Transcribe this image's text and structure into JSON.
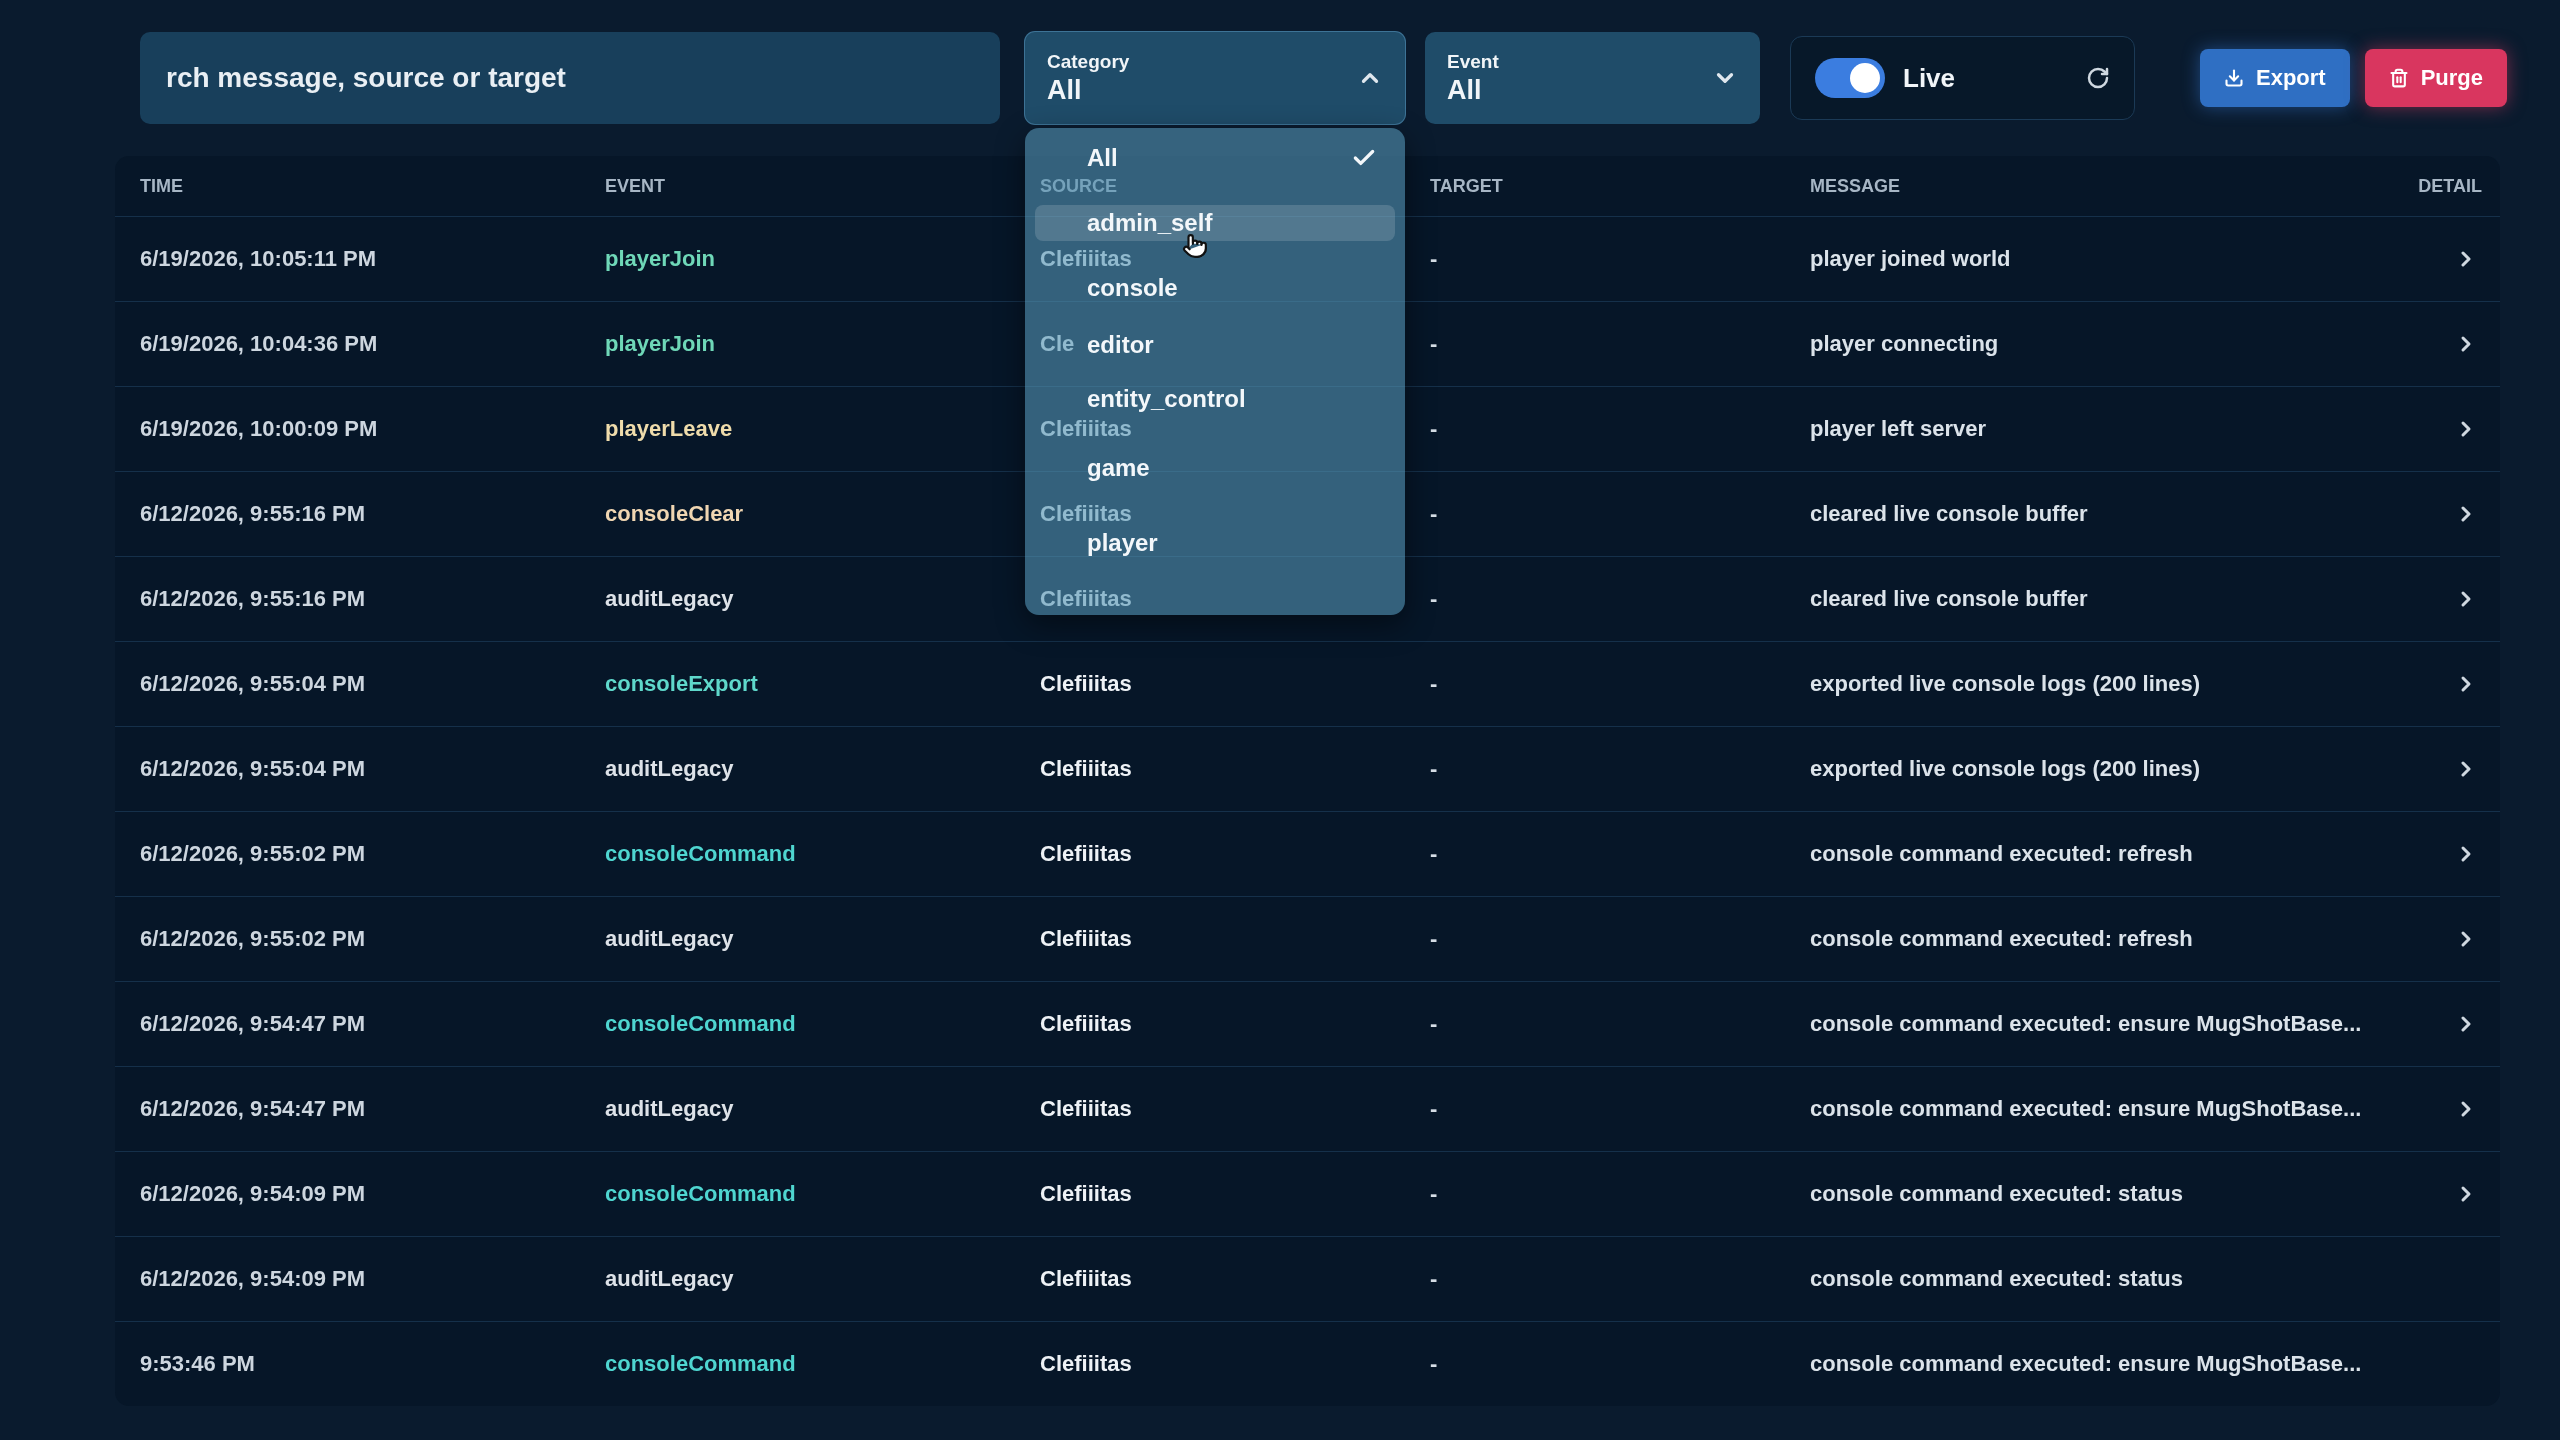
{
  "toolbar": {
    "search": {
      "placeholder": "rch message, source or target"
    },
    "category": {
      "label": "Category",
      "value": "All",
      "expanded": true,
      "options": [
        {
          "label": "All",
          "selected": true,
          "hovered": false
        },
        {
          "label": "admin_self",
          "selected": false,
          "hovered": true
        },
        {
          "label": "console",
          "selected": false,
          "hovered": false
        },
        {
          "label": "editor",
          "selected": false,
          "hovered": false
        },
        {
          "label": "entity_control",
          "selected": false,
          "hovered": false
        },
        {
          "label": "game",
          "selected": false,
          "hovered": false
        },
        {
          "label": "player",
          "selected": false,
          "hovered": false
        }
      ]
    },
    "event": {
      "label": "Event",
      "value": "All",
      "expanded": false
    },
    "live": {
      "label": "Live",
      "on": true
    },
    "buttons": [
      {
        "kind": "export",
        "label": "Export"
      },
      {
        "kind": "purge",
        "label": "Purge"
      }
    ]
  },
  "table": {
    "columns": [
      "TIME",
      "EVENT",
      "SOURCE",
      "TARGET",
      "MESSAGE",
      "DETAIL"
    ],
    "rows": [
      {
        "time": "6/19/2026, 10:05:11 PM",
        "event": "playerJoin",
        "color": "#6fd8b8",
        "source": "Clefiiitas",
        "target": "-",
        "message": "player joined world",
        "detail_arrow": true
      },
      {
        "time": "6/19/2026, 10:04:36 PM",
        "event": "playerJoin",
        "color": "#6fd8b8",
        "source": "Cle",
        "target": "-",
        "message": "player connecting",
        "detail_arrow": true
      },
      {
        "time": "6/19/2026, 10:00:09 PM",
        "event": "playerLeave",
        "color": "#efdcab",
        "source": "Clefiiitas",
        "target": "-",
        "message": "player left server",
        "detail_arrow": true
      },
      {
        "time": "6/12/2026, 9:55:16 PM",
        "event": "consoleClear",
        "color": "#f0d6b2",
        "source": "Clefiiitas",
        "target": "-",
        "message": "cleared live console buffer",
        "detail_arrow": true
      },
      {
        "time": "6/12/2026, 9:55:16 PM",
        "event": "auditLegacy",
        "color": "#dde2e8",
        "source": "Clefiiitas",
        "target": "-",
        "message": "cleared live console buffer",
        "detail_arrow": true
      },
      {
        "time": "6/12/2026, 9:55:04 PM",
        "event": "consoleExport",
        "color": "#5fd8cb",
        "source": "Clefiiitas",
        "target": "-",
        "message": "exported live console logs (200 lines)",
        "detail_arrow": true
      },
      {
        "time": "6/12/2026, 9:55:04 PM",
        "event": "auditLegacy",
        "color": "#dde2e8",
        "source": "Clefiiitas",
        "target": "-",
        "message": "exported live console logs (200 lines)",
        "detail_arrow": true
      },
      {
        "time": "6/12/2026, 9:55:02 PM",
        "event": "consoleCommand",
        "color": "#4fd6d0",
        "source": "Clefiiitas",
        "target": "-",
        "message": "console command executed: refresh",
        "detail_arrow": true
      },
      {
        "time": "6/12/2026, 9:55:02 PM",
        "event": "auditLegacy",
        "color": "#dde2e8",
        "source": "Clefiiitas",
        "target": "-",
        "message": "console command executed: refresh",
        "detail_arrow": true
      },
      {
        "time": "6/12/2026, 9:54:47 PM",
        "event": "consoleCommand",
        "color": "#4fd6d0",
        "source": "Clefiiitas",
        "target": "-",
        "message": "console command executed: ensure MugShotBase...",
        "detail_arrow": true
      },
      {
        "time": "6/12/2026, 9:54:47 PM",
        "event": "auditLegacy",
        "color": "#dde2e8",
        "source": "Clefiiitas",
        "target": "-",
        "message": "console command executed: ensure MugShotBase...",
        "detail_arrow": true
      },
      {
        "time": "6/12/2026, 9:54:09 PM",
        "event": "consoleCommand",
        "color": "#4fd6d0",
        "source": "Clefiiitas",
        "target": "-",
        "message": "console command executed: status",
        "detail_arrow": true
      },
      {
        "time": "6/12/2026, 9:54:09 PM",
        "event": "auditLegacy",
        "color": "#dde2e8",
        "source": "Clefiiitas",
        "target": "-",
        "message": "console command executed: status",
        "detail_arrow": false
      },
      {
        "time": "9:53:46 PM",
        "event": "consoleCommand",
        "color": "#4fd6d0",
        "source": "Clefiiitas",
        "target": "-",
        "message": "console command executed: ensure MugShotBase...",
        "detail_arrow": false
      }
    ]
  }
}
